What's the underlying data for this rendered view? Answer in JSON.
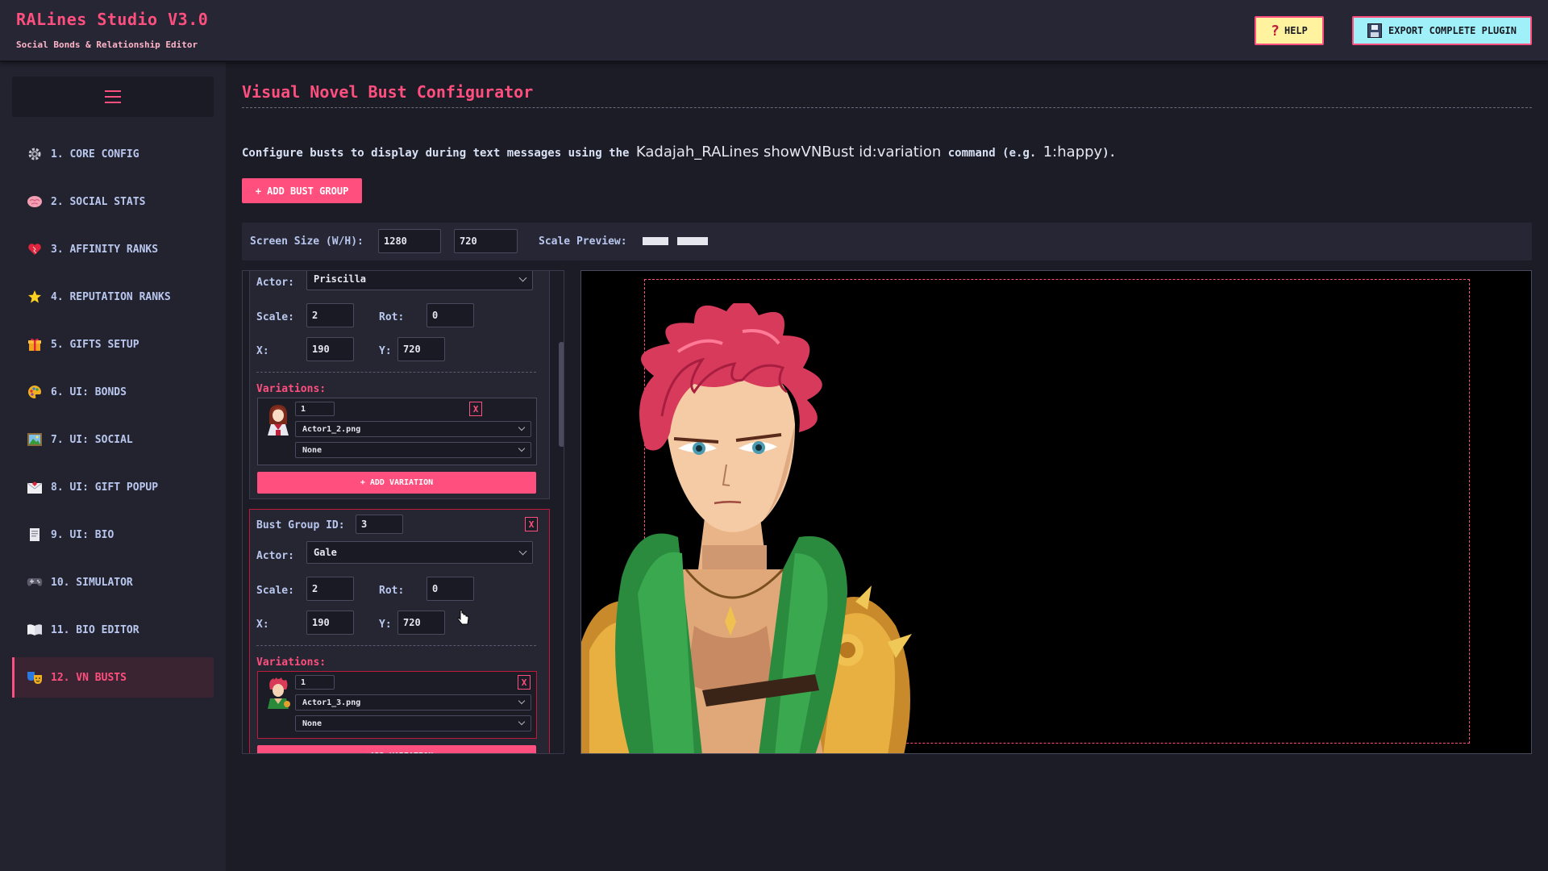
{
  "app": {
    "title": "RALines Studio V3.0",
    "subtitle": "Social Bonds & Relationship Editor",
    "help_label": "HELP",
    "export_label": "EXPORT COMPLETE PLUGIN"
  },
  "sidebar": {
    "menu_icon": "hamburger-icon",
    "items": [
      {
        "label": "1. CORE CONFIG",
        "icon": "gear-icon"
      },
      {
        "label": "2. SOCIAL STATS",
        "icon": "brain-icon"
      },
      {
        "label": "3. AFFINITY RANKS",
        "icon": "heart-icon"
      },
      {
        "label": "4. REPUTATION RANKS",
        "icon": "star-icon"
      },
      {
        "label": "5. GIFTS SETUP",
        "icon": "gift-icon"
      },
      {
        "label": "6. UI: BONDS",
        "icon": "palette-icon"
      },
      {
        "label": "7. UI: SOCIAL",
        "icon": "picture-icon"
      },
      {
        "label": "8. UI: GIFT POPUP",
        "icon": "envelope-icon"
      },
      {
        "label": "9. UI: BIO",
        "icon": "document-icon"
      },
      {
        "label": "10. SIMULATOR",
        "icon": "gamepad-icon"
      },
      {
        "label": "11. BIO EDITOR",
        "icon": "book-icon"
      },
      {
        "label": "12. VN BUSTS",
        "icon": "masks-icon",
        "active": true
      }
    ]
  },
  "main": {
    "title": "Visual Novel Bust Configurator",
    "desc_prefix": "Configure busts to display during text messages using the ",
    "desc_code": "Kadajah_RALines showVNBust id:variation",
    "desc_mid": " command (e.g. ",
    "desc_example": "1:happy",
    "desc_suffix": ").",
    "add_group_label": "+ ADD BUST GROUP",
    "screen_size_label": "Screen Size (W/H):",
    "screen_width": "1280",
    "screen_height": "720",
    "scale_preview_label": "Scale Preview:"
  },
  "labels": {
    "actor": "Actor:",
    "scale": "Scale:",
    "rot": "Rot:",
    "x": "X:",
    "y": "Y:",
    "variations": "Variations:",
    "bust_group_id": "Bust Group ID:",
    "add_variation": "+ ADD VARIATION",
    "remove": "X"
  },
  "groups": [
    {
      "actor": "Priscilla",
      "scale": "2",
      "rot": "0",
      "x": "190",
      "y": "720",
      "variation": {
        "id": "1",
        "image": "Actor1_2.png",
        "option": "None"
      }
    },
    {
      "id": "3",
      "actor": "Gale",
      "scale": "2",
      "rot": "0",
      "x": "190",
      "y": "720",
      "variation": {
        "id": "1",
        "image": "Actor1_3.png",
        "option": "None"
      }
    }
  ],
  "colors": {
    "accent": "#ff4f7e",
    "help_bg": "#fff3a0",
    "export_bg": "#9ff0f8",
    "sidebar_text": "#b9c7ee"
  }
}
